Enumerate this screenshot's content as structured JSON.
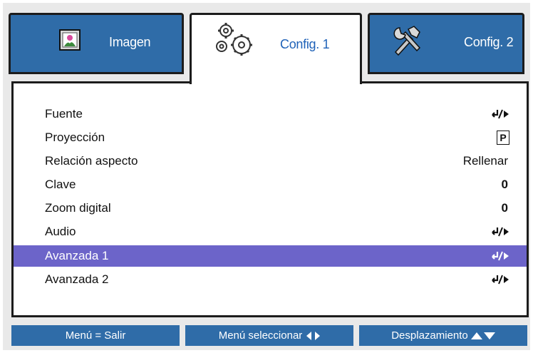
{
  "tabs": [
    {
      "label": "Imagen",
      "icon": "picture-icon",
      "active": false
    },
    {
      "label": "Config. 1",
      "icon": "gears-icon",
      "active": true
    },
    {
      "label": "Config. 2",
      "icon": "tools-icon",
      "active": false
    }
  ],
  "menu": {
    "items": [
      {
        "label": "Fuente",
        "value_type": "enter-icon"
      },
      {
        "label": "Proyección",
        "value": "P"
      },
      {
        "label": "Relación aspecto",
        "value": "Rellenar"
      },
      {
        "label": "Clave",
        "value": "0"
      },
      {
        "label": "Zoom digital",
        "value": "0"
      },
      {
        "label": "Audio",
        "value_type": "enter-icon"
      },
      {
        "label": "Avanzada 1",
        "value_type": "enter-icon",
        "selected": true
      },
      {
        "label": "Avanzada 2",
        "value_type": "enter-icon"
      }
    ]
  },
  "footer": {
    "exit": "Menú = Salir",
    "select": "Menú seleccionar",
    "scroll": "Desplazamiento"
  },
  "colors": {
    "tab_blue": "#2f6ca8",
    "active_tab_text": "#1f62b8",
    "selection": "#6c64c9"
  }
}
